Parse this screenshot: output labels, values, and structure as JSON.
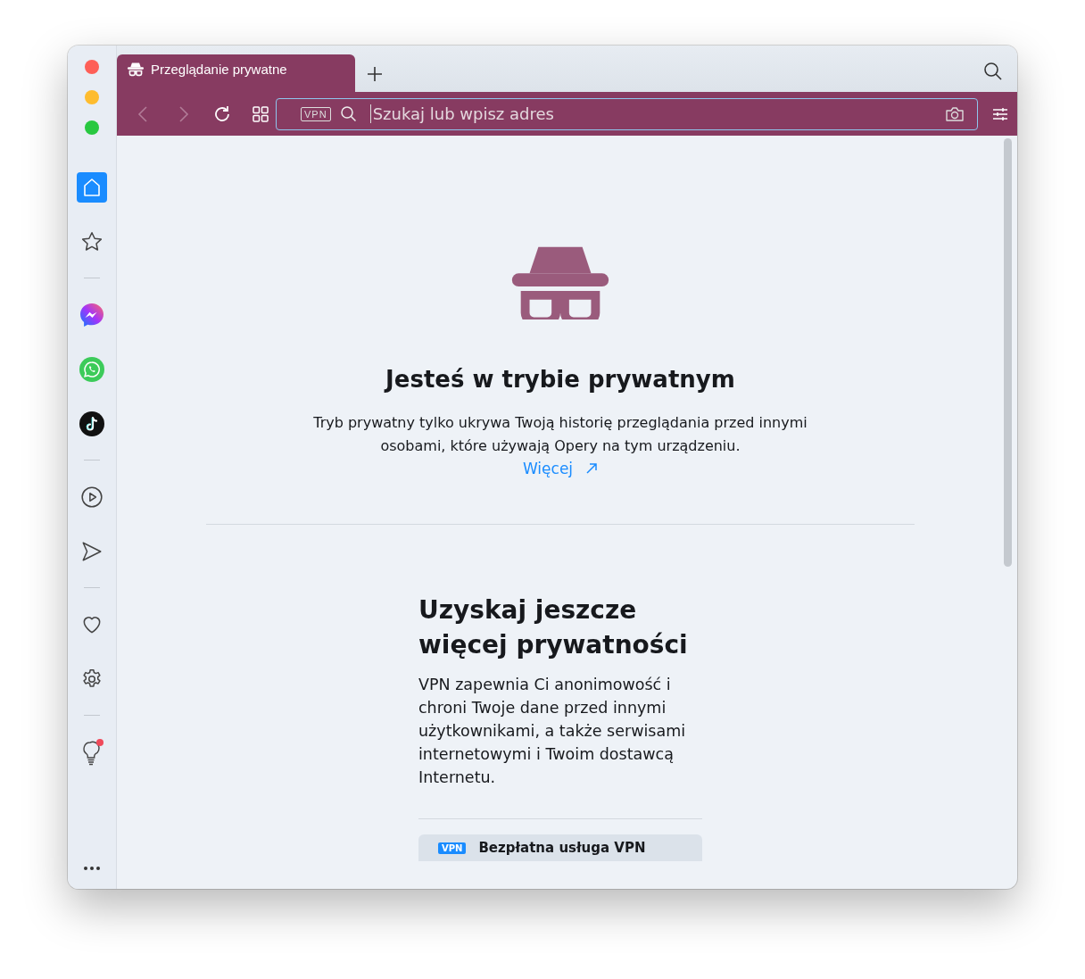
{
  "tab": {
    "title": "Przeglądanie prywatne",
    "selected": true
  },
  "toolbar": {
    "vpn_badge": "VPN",
    "address": {
      "placeholder": "Szukaj lub wpisz adres"
    }
  },
  "sidebar": {
    "items": [
      {
        "kind": "home",
        "selected": true
      },
      {
        "kind": "star",
        "selected": false
      },
      {
        "kind": "divider"
      },
      {
        "kind": "messenger",
        "selected": false
      },
      {
        "kind": "whatsapp",
        "selected": false
      },
      {
        "kind": "tiktok",
        "selected": false
      },
      {
        "kind": "divider"
      },
      {
        "kind": "player",
        "selected": false
      },
      {
        "kind": "send",
        "selected": false
      },
      {
        "kind": "divider"
      },
      {
        "kind": "heart",
        "selected": false
      },
      {
        "kind": "gear",
        "selected": false
      },
      {
        "kind": "divider"
      },
      {
        "kind": "bulb",
        "selected": false,
        "badge": true
      }
    ]
  },
  "private": {
    "title": "Jesteś w trybie prywatnym",
    "text": "Tryb prywatny tylko ukrywa Twoją historię przeglądania przed innymi osobami, które używają Opery na tym urządzeniu.",
    "link": "Więcej"
  },
  "vpn_promo": {
    "title": "Uzyskaj jeszcze więcej prywatności",
    "text": "VPN zapewnia Ci anonimowość i chroni Twoje dane przed innymi użytkownikami, a także serwisami internetowymi i Twoim dostawcą Internetu.",
    "card": {
      "badge": "VPN",
      "label": "Bezpłatna usługa VPN"
    }
  }
}
